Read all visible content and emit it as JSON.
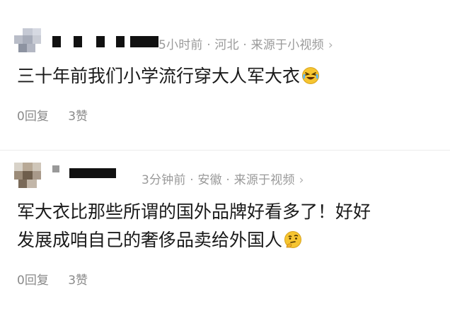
{
  "comments": [
    {
      "meta": "5小时前 · 河北 · 来源于小视频",
      "chevron": "›",
      "text": "三十年前我们小学流行穿大人军大衣",
      "emoji_icon": "laughing-tears-icon",
      "reply": "0回复",
      "like": "3赞"
    },
    {
      "meta": "3分钟前 · 安徽 · 来源于视频",
      "chevron": "›",
      "text_line1": "军大衣比那些所谓的国外品牌好看多了！好好",
      "text_line2": "发展成咱自己的奢侈品卖给外国人",
      "emoji_icon": "thinking-face-icon",
      "reply": "0回复",
      "like": "3赞"
    }
  ],
  "colors": {
    "meta": "#9a9a9a",
    "text": "#1a1a1a",
    "emoji": "#f6c531"
  }
}
